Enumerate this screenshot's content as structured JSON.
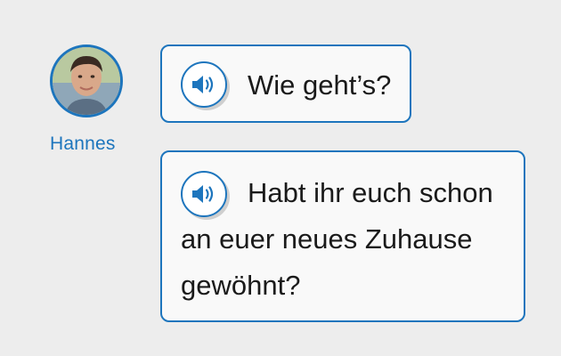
{
  "speaker": {
    "name": "Hannes",
    "avatar_icon": "person-avatar"
  },
  "messages": [
    {
      "text": "Wie geht’s?",
      "audio_icon": "speaker-volume-icon"
    },
    {
      "text": "Habt ihr euch schon an euer neues Zuhause gewöhnt?",
      "audio_icon": "speaker-volume-icon"
    }
  ],
  "colors": {
    "accent": "#1d75bd",
    "background": "#ededed",
    "bubble": "#f9f9f9",
    "text": "#1a1a1a"
  }
}
